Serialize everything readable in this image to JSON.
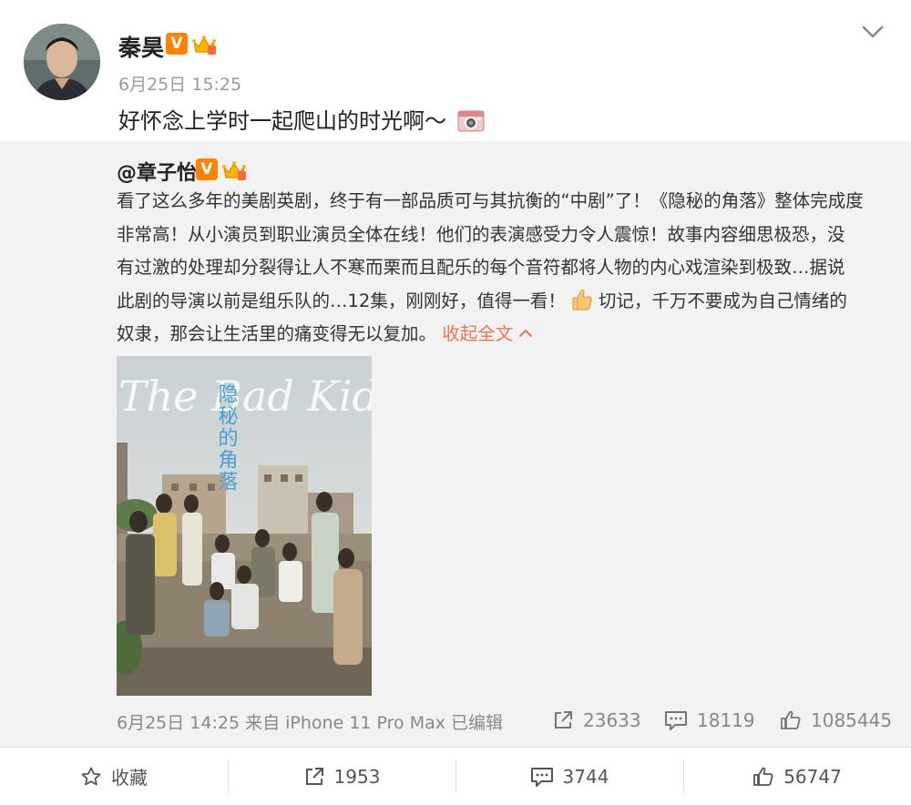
{
  "post": {
    "author": "秦昊",
    "time": "6月25日 15:25",
    "text": "好怀念上学时一起爬山的时光啊～",
    "icon_more": "chevron-down-icon",
    "icon_verified": "verified-v-icon",
    "icon_crown": "crown-icon",
    "icon_camera": "camera-icon"
  },
  "repost": {
    "author": "@章子怡",
    "line1": "看了这么多年的美剧英剧，终于有一部品质可与其抗衡的“中剧”了！《隐秘的角落》整体完成度",
    "line2": "非常高！从小演员到职业演员全体在线！他们的表演感受力令人震惊！故事内容细思极恐，没",
    "line3": "有过激的处理却分裂得让人不寒而栗而且配乐的每个音符都将人物的内心戏渲染到极致…据说",
    "line4a": "此剧的导演以前是组乐队的…12集，刚刚好，值得一看！",
    "line4b": "切记，千万不要成为自己情绪的",
    "line5": "奴隶，那会让生活里的痛变得无以复加。",
    "collapse_label": "收起全文",
    "poster": {
      "title_en": "The Bad Kids",
      "title_cn": "隐秘的角落"
    },
    "meta": "6月25日 14:25 来自 iPhone 11 Pro Max   已编辑",
    "reposts": "23633",
    "comments": "18119",
    "likes": "1085445"
  },
  "actions": {
    "favorite": "收藏",
    "repost": "1953",
    "comment": "3744",
    "like": "56747"
  },
  "colors": {
    "accent": "#eb7350",
    "verified": "#ff8200",
    "repost_bg": "#f2f2f2"
  }
}
